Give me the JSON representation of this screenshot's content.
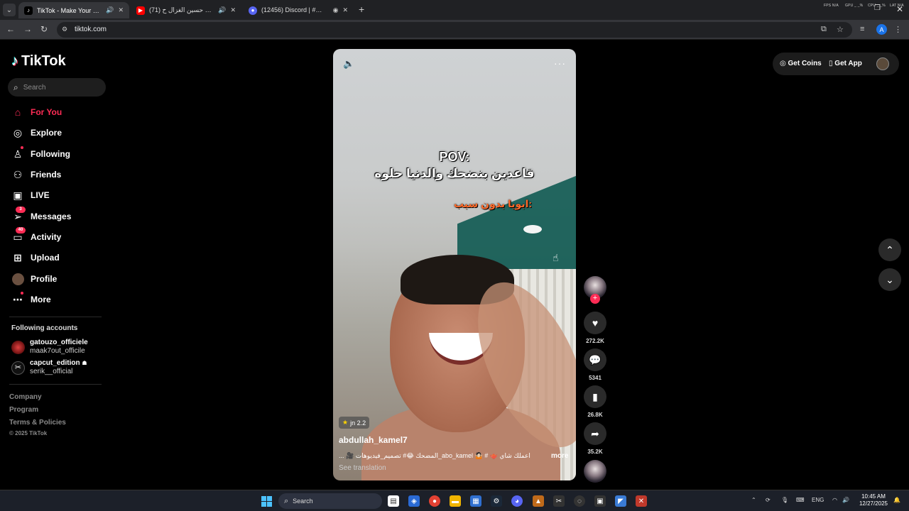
{
  "browser": {
    "tabs": [
      {
        "title": "TikTok - Make Your Day",
        "favicon": "tiktok-icon",
        "audio": true,
        "active": true
      },
      {
        "title": "(71) ريمكس حسين الغزال ح...",
        "favicon": "youtube-icon",
        "audio": true,
        "active": false
      },
      {
        "title": "(12456) Discord | #😊 - ...",
        "favicon": "discord-icon",
        "audio": false,
        "active": false
      }
    ],
    "url": "tiktok.com",
    "profile_letter": "A",
    "sys_indicators": [
      "FPS N/A",
      "GPU _ _%",
      "CPU _ _%",
      "LAT N/A"
    ]
  },
  "sidebar": {
    "logo": "TikTok",
    "search_placeholder": "Search",
    "items": [
      {
        "label": "For You",
        "icon": "home-icon",
        "active": true
      },
      {
        "label": "Explore",
        "icon": "compass-icon"
      },
      {
        "label": "Following",
        "icon": "following-icon",
        "dot": true
      },
      {
        "label": "Friends",
        "icon": "friends-icon"
      },
      {
        "label": "LIVE",
        "icon": "live-icon"
      },
      {
        "label": "Messages",
        "icon": "send-icon",
        "badge": "3"
      },
      {
        "label": "Activity",
        "icon": "inbox-icon",
        "badge": "40"
      },
      {
        "label": "Upload",
        "icon": "plus-square-icon"
      },
      {
        "label": "Profile",
        "icon": "avatar"
      },
      {
        "label": "More",
        "icon": "ellipsis-icon",
        "dot": true
      }
    ],
    "following_heading": "Following accounts",
    "following": [
      {
        "name": "gatouzo_officiele",
        "username": "maak7out_officile"
      },
      {
        "name": "capcut_edition",
        "username": "serik__official"
      }
    ],
    "footer": [
      "Company",
      "Program",
      "Terms & Policies"
    ],
    "copyright": "© 2025 TikTok"
  },
  "video": {
    "overlay_line1": "POV:",
    "overlay_line2": "قاعدين بنضحك والدنيا حلوه",
    "overlay_line3": "ابويا بدون سبب:",
    "effect_label": "jn 2.2",
    "author": "abdullah_kamel7",
    "description": "اعملك شاي 🫖 # 🤷🏻 abo_kamel_المضحك 😂# تصميم_فيديوهات 🎥 ...",
    "more_label": "more",
    "translation_label": "See translation"
  },
  "actions": {
    "likes": "272.2K",
    "comments": "5341",
    "saves": "26.8K",
    "shares": "35.2K"
  },
  "header_right": {
    "get_coins": "Get Coins",
    "get_app": "Get App"
  },
  "taskbar": {
    "search_placeholder": "Search",
    "language": "ENG",
    "time": "10:45 AM",
    "date": "12/27/2025"
  },
  "colors": {
    "accent": "#fe2c55",
    "background": "#000000",
    "taskbar": "#1c2029"
  }
}
